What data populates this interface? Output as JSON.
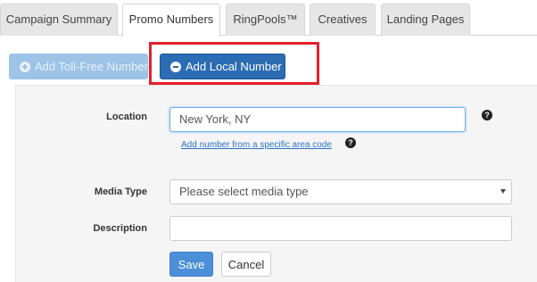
{
  "tabs": [
    {
      "label": "Campaign Summary",
      "active": false
    },
    {
      "label": "Promo Numbers",
      "active": true
    },
    {
      "label": "RingPools™",
      "active": false
    },
    {
      "label": "Creatives",
      "active": false
    },
    {
      "label": "Landing Pages",
      "active": false
    }
  ],
  "actions": {
    "add_toll_free": "Add Toll-Free Number",
    "add_local": "Add Local Number"
  },
  "form": {
    "location": {
      "label": "Location",
      "value": "New York, NY",
      "help_icon": "question-circle-icon"
    },
    "area_code_link": "Add number from a specific area code",
    "media_type": {
      "label": "Media Type",
      "selected": "Please select media type"
    },
    "description": {
      "label": "Description",
      "value": ""
    }
  },
  "buttons": {
    "save": "Save",
    "cancel": "Cancel"
  },
  "colors": {
    "primary": "#2b6cb3",
    "disabled": "#9dc3e6",
    "highlight": "#e2202a",
    "link": "#2b74c7"
  }
}
